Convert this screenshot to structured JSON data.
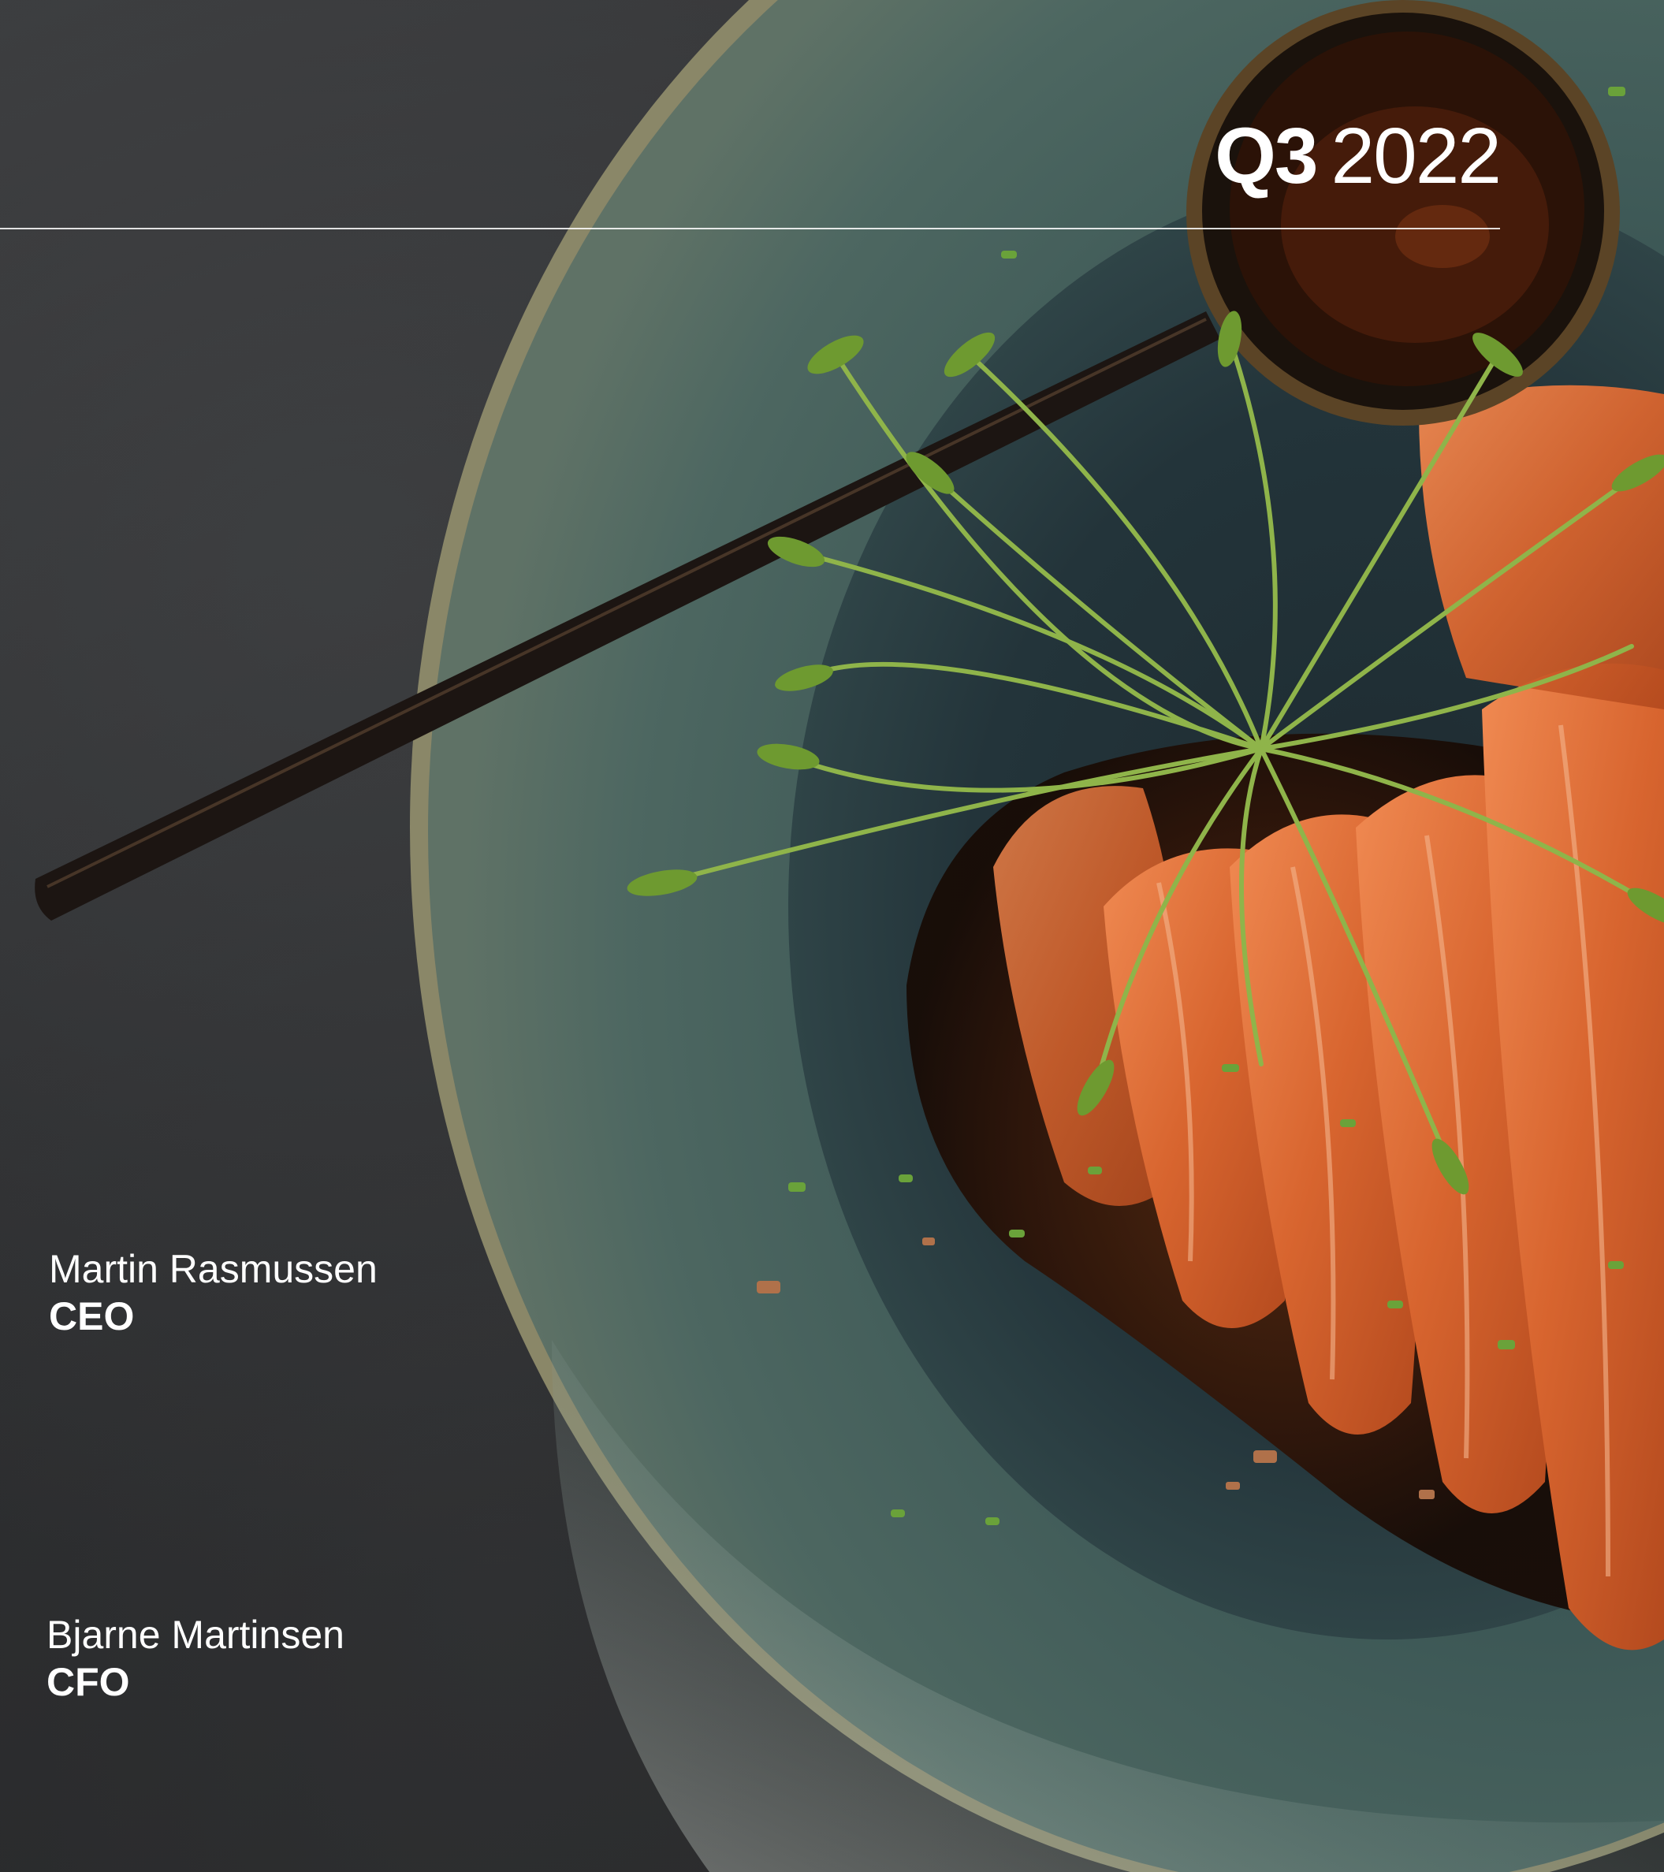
{
  "cover": {
    "period": {
      "quarter": "Q3",
      "year": "2022"
    },
    "people": [
      {
        "name": "Martin Rasmussen",
        "role": "CEO"
      },
      {
        "name": "Bjarne Martinsen",
        "role": "CFO"
      }
    ]
  },
  "photo": {
    "subject": "salmon-sashimi-plate-icon",
    "colors": {
      "slate_background": "#2b2c2e",
      "plate_glaze": "#3f5a57",
      "plate_rim": "#8c8a6a",
      "salmon": "#d9703e",
      "sprouts": "#7aa23a",
      "sauce": "#3a1a0a",
      "spoon": "#1c1512"
    }
  }
}
